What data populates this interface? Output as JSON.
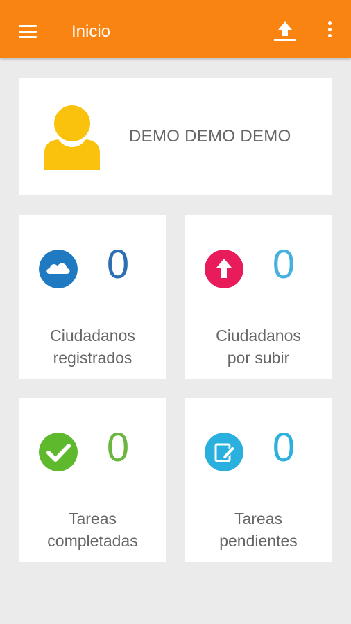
{
  "appbar": {
    "title": "Inicio",
    "color": "#fa8412",
    "icons": [
      "menu-icon",
      "upload-icon",
      "more-vertical-icon"
    ]
  },
  "profile": {
    "name": "DEMO DEMO DEMO",
    "avatar_icon": "user-icon",
    "avatar_color": "#fbc20d"
  },
  "stats": [
    {
      "value": "0",
      "label_line1": "Ciudadanos",
      "label_line2": "registrados",
      "icon": "cloud-icon",
      "icon_color": "#1f7ac2",
      "value_color": "#2c6fb3"
    },
    {
      "value": "0",
      "label_line1": "Ciudadanos",
      "label_line2": "por subir",
      "icon": "upload-arrow-icon",
      "icon_color": "#e81b5b",
      "value_color": "#45b1e0"
    },
    {
      "value": "0",
      "label_line1": "Tareas",
      "label_line2": "completadas",
      "icon": "checkmark-icon",
      "icon_color": "#5eb92c",
      "value_color": "#6ab640"
    },
    {
      "value": "0",
      "label_line1": "Tareas",
      "label_line2": "pendientes",
      "icon": "edit-icon",
      "icon_color": "#2ab0de",
      "value_color": "#2bb0df"
    }
  ]
}
